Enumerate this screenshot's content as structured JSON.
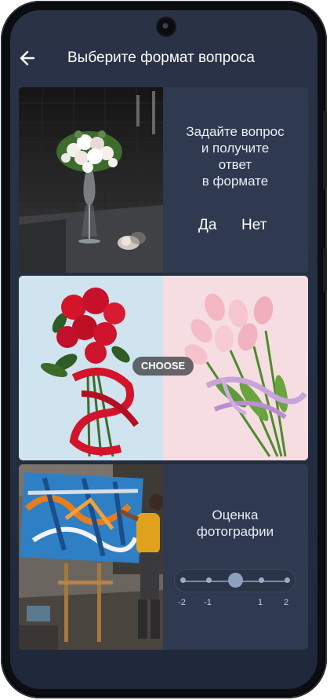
{
  "header": {
    "title": "Выберите формат вопроса"
  },
  "cards": {
    "yes_no": {
      "text_lines": [
        "Задайте вопрос",
        "и получите",
        "ответ",
        "в формате"
      ],
      "yes_label": "Да",
      "no_label": "Нет"
    },
    "choose": {
      "badge_label": "CHOOSE"
    },
    "rating": {
      "title_lines": [
        "Оценка",
        "фотографии"
      ],
      "scale_labels": [
        "-2",
        "-1",
        "1",
        "2"
      ],
      "current_value": 0
    }
  },
  "colors": {
    "background": "#253044",
    "card": "#2f3a50",
    "text": "#ffffff",
    "accent": "#8ea0c2"
  }
}
